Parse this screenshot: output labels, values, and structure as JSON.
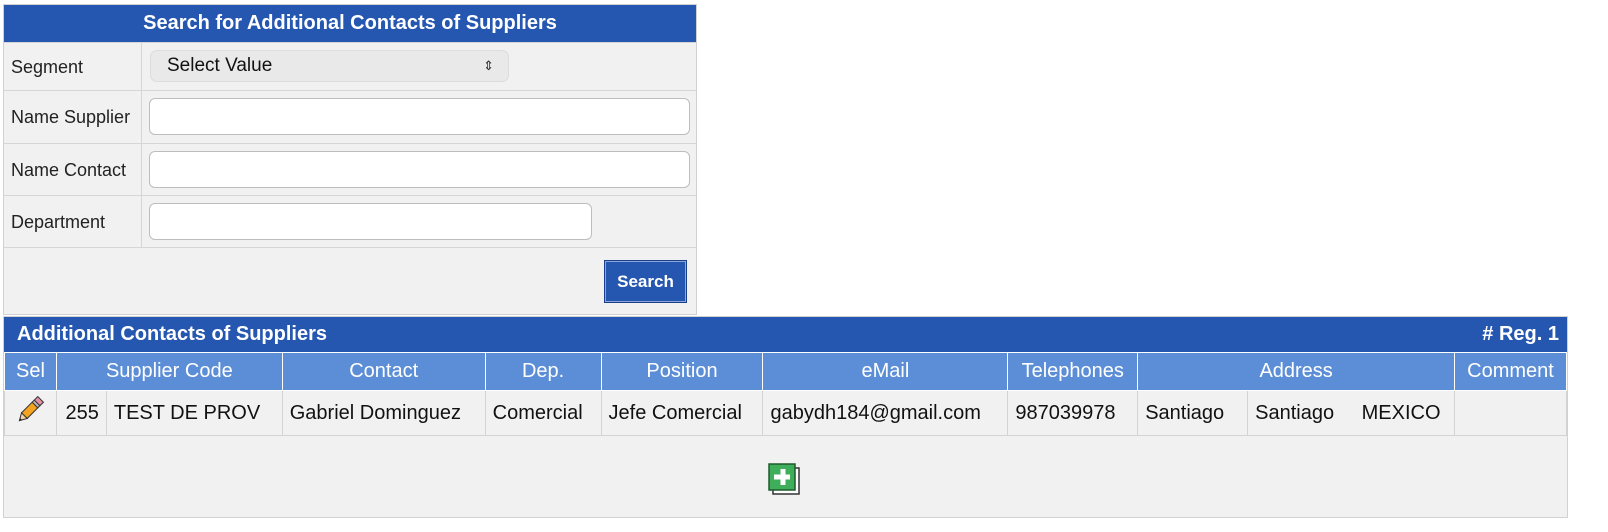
{
  "search_form": {
    "title": "Search for Additional Contacts of Suppliers",
    "segment_label": "Segment",
    "segment_value": "Select Value",
    "name_supplier_label": "Name Supplier",
    "name_supplier_value": "",
    "name_contact_label": "Name Contact",
    "name_contact_value": "",
    "department_label": "Department",
    "department_value": "",
    "search_button": "Search"
  },
  "results": {
    "title": "Additional Contacts of Suppliers",
    "count": "# Reg. 1",
    "columns": [
      "Sel",
      "Supplier Code",
      "Contact",
      "Dep.",
      "Position",
      "eMail",
      "Telephones",
      "Address",
      "Comment"
    ],
    "rows": [
      {
        "sel_icon": "pencil-icon",
        "code": "255",
        "supplier": "TEST DE PROV",
        "contact": "Gabriel Dominguez",
        "dep": "Comercial",
        "position": "Jefe Comercial",
        "email": "gabydh184@gmail.com",
        "telephones": "987039978",
        "address_city": "Santiago",
        "address_region": "Santiago",
        "address_country": "MEXICO",
        "comment": ""
      }
    ],
    "add_icon": "add-record-icon"
  },
  "colors": {
    "header_blue": "#2657b0",
    "column_header_blue": "#5b8ed6",
    "panel_gray": "#f1f1f1"
  }
}
